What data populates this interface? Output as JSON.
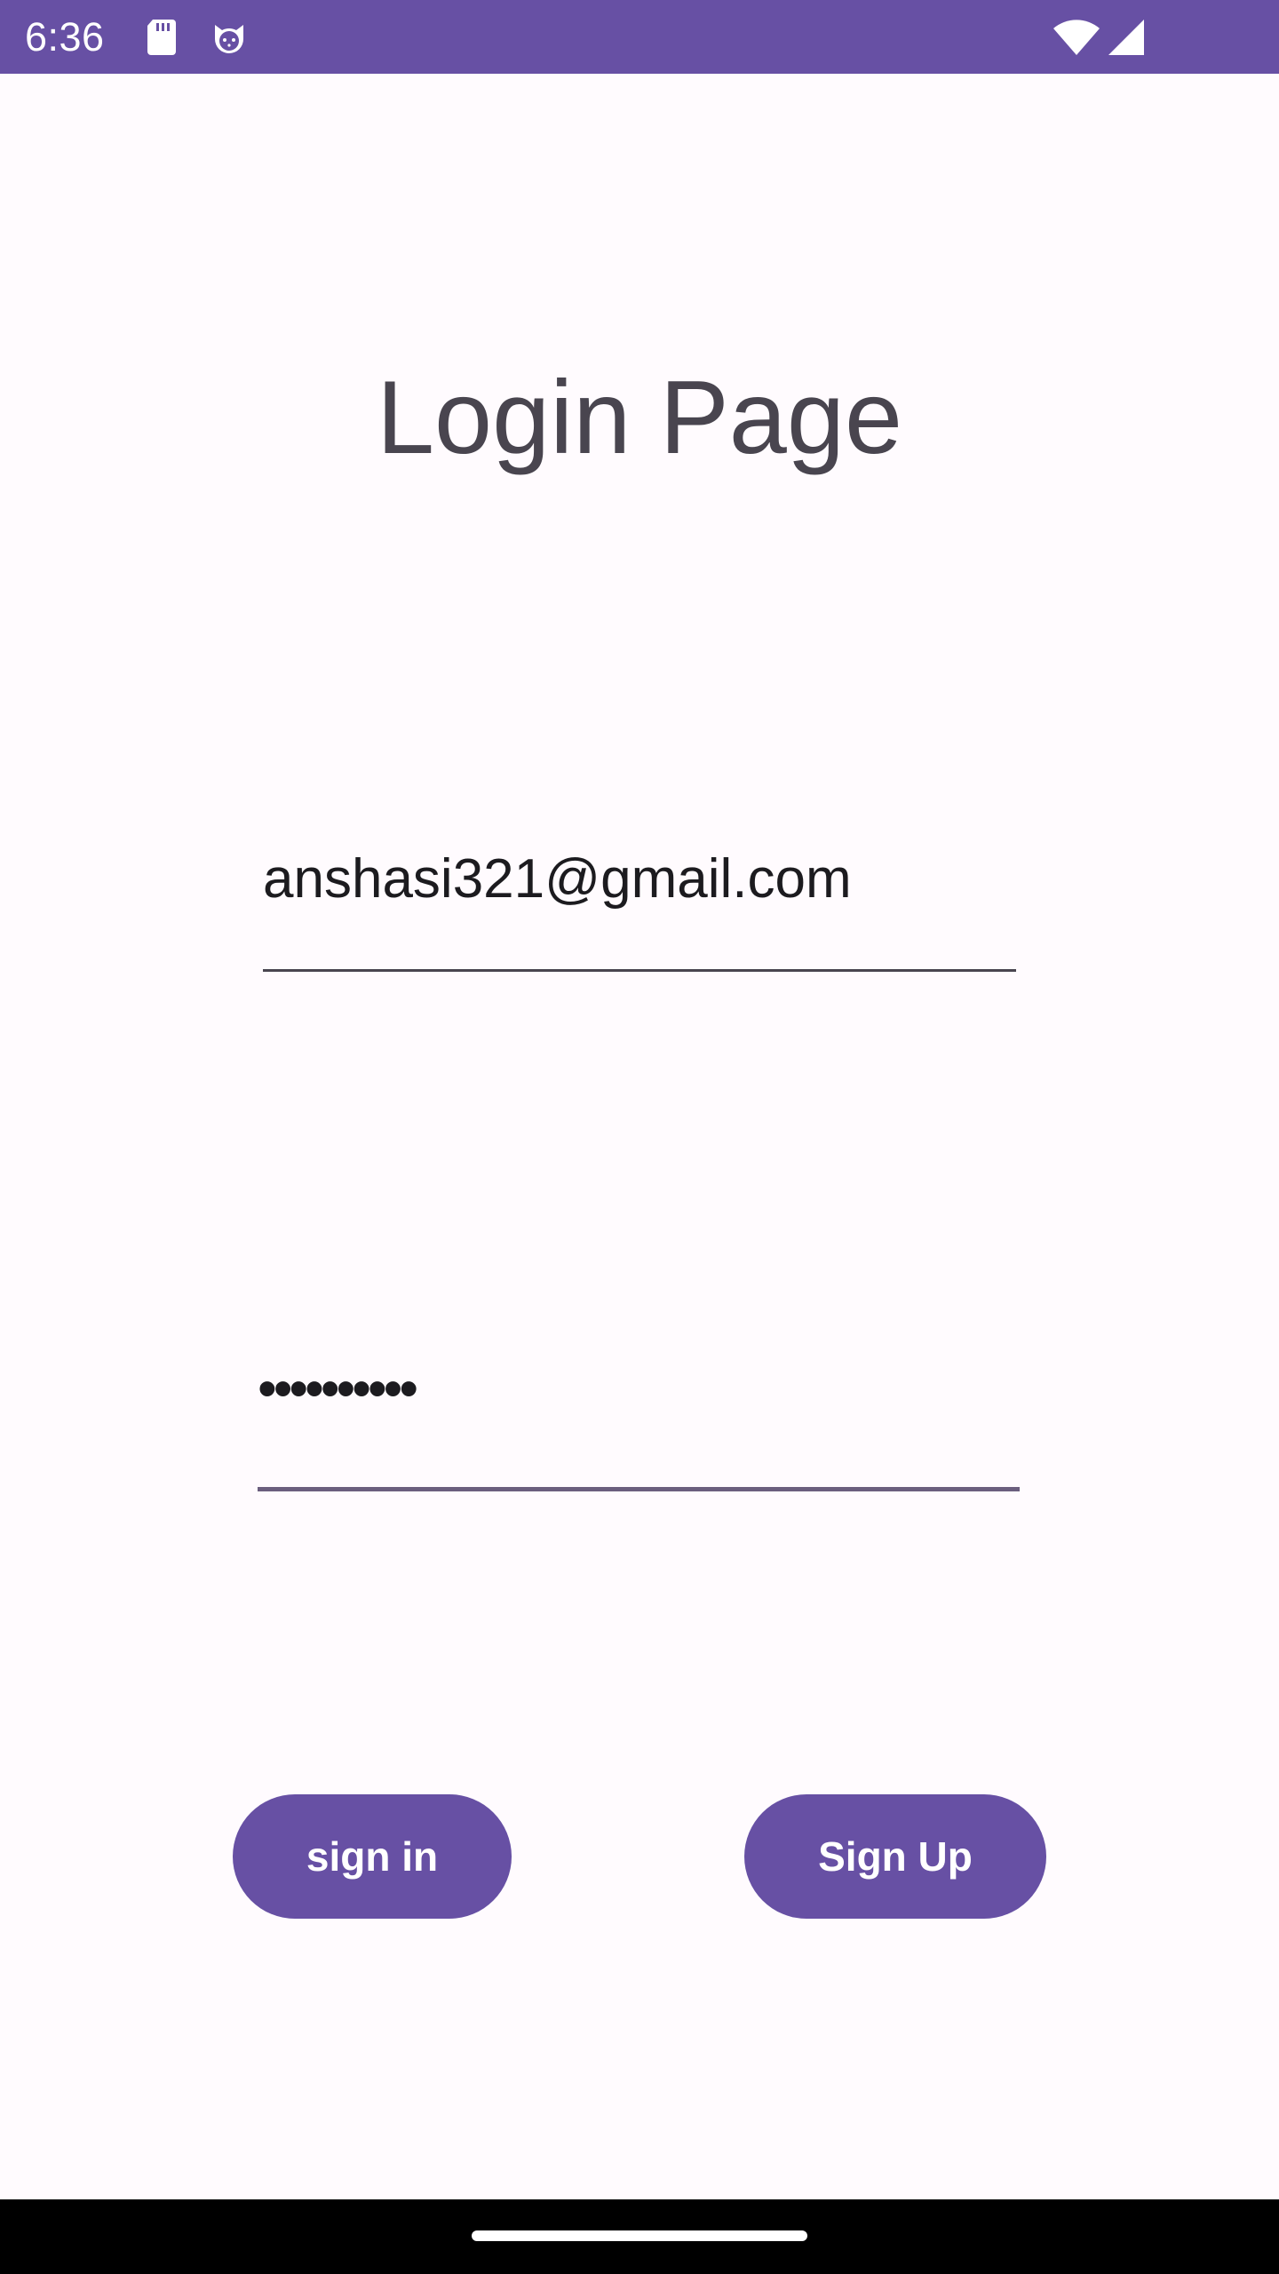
{
  "status_bar": {
    "time": "6:36",
    "icons": [
      "sd-card-icon",
      "cat-face-icon",
      "wifi-icon",
      "cellular-signal-icon"
    ]
  },
  "page": {
    "title": "Login Page"
  },
  "form": {
    "email_value": "anshasi321@gmail.com",
    "password_masked": "••••••••••",
    "signin_label": "sign in",
    "signup_label": "Sign Up"
  },
  "colors": {
    "primary": "#6750A4",
    "background": "#FFFBFE",
    "title_text": "#49454F",
    "input_text": "#1C1B1F",
    "nav_bar": "#000000"
  }
}
